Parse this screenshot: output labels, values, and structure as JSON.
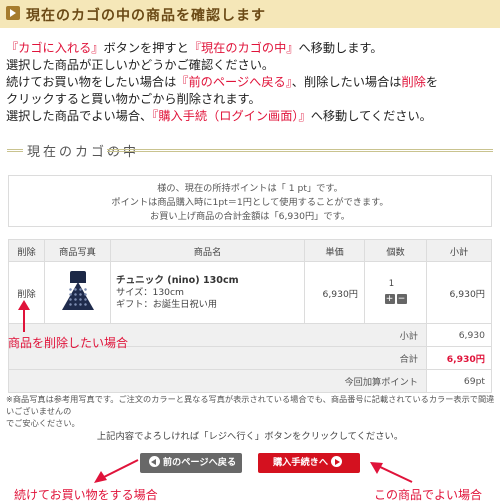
{
  "header": {
    "title": "現在のカゴの中の商品を確認します"
  },
  "intro": {
    "l1_a": "『カゴに入れる』",
    "l1_b": "ボタンを押すと",
    "l1_c": "『現在のカゴの中』",
    "l1_d": "へ移動します。",
    "l2": "選択した商品が正しいかどうかご確認ください。",
    "l3_a": "続けてお買い物をしたい場合は",
    "l3_b": "『前のページへ戻る』",
    "l3_c": "、削除したい場合は",
    "l3_d": "削除",
    "l3_e": "を",
    "l4": "クリックすると買い物かごから削除されます。",
    "l5_a": "選択した商品でよい場合、",
    "l5_b": "『購入手続（ログイン画面）』",
    "l5_c": "へ移動してください。"
  },
  "section": {
    "title": "現在のカゴの中"
  },
  "points": {
    "line1": "様の、現在の所持ポイントは「 1 pt」です。",
    "line2": "ポイントは商品購入時に1pt＝1円として使用することができます。",
    "line3": "お買い上げ商品の合計金額は「6,930円」です。"
  },
  "table": {
    "headers": [
      "削除",
      "商品写真",
      "商品名",
      "単価",
      "個数",
      "小計"
    ],
    "item": {
      "delete_label": "削除",
      "name": "チュニック (nino) 130cm",
      "size": "サイズ：130cm",
      "gift": "ギフト：お誕生日祝い用",
      "price": "6,930円",
      "qty": "1",
      "subtotal": "6,930円"
    },
    "summary": {
      "subtotal_label": "小計",
      "subtotal_value": "6,930",
      "total_label": "合計",
      "total_value": "6,930円",
      "points_label": "今回加算ポイント",
      "points_value": "69pt"
    }
  },
  "note": {
    "line1": "※商品写真は参考用写真です。ご注文のカラーと異なる写真が表示されている場合でも、商品番号に記載されているカラー表示で間違いございませんの",
    "line2": "でご安心ください。"
  },
  "confirm_text": "上記内容でよろしければ「レジへ行く」ボタンをクリックしてください。",
  "buttons": {
    "back": "前のページへ戻る",
    "next": "購入手続きへ"
  },
  "annotations": {
    "delete": "商品を削除したい場合",
    "continue": "続けてお買い物をする場合",
    "ok": "この商品でよい場合"
  },
  "colors": {
    "accent_red": "#e0133a",
    "header_bg": "#f5e7b8",
    "button_gray": "#686868",
    "button_red": "#d4111f"
  }
}
